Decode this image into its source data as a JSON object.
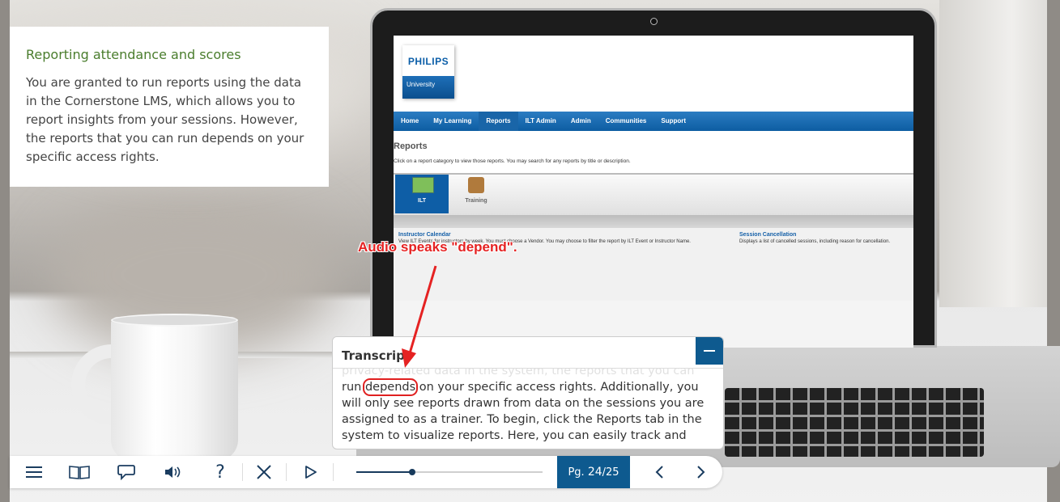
{
  "info_panel": {
    "title": "Reporting attendance and scores",
    "body": "You are granted to run reports using the data in the Cornerstone LMS, which allows you to report insights from your sessions. However, the reports that you can run depends on your specific access rights."
  },
  "laptop_screen": {
    "brand": "PHILIPS",
    "brand_sub": "University",
    "nav": [
      "Home",
      "My Learning",
      "Reports",
      "ILT Admin",
      "Admin",
      "Communities",
      "Support"
    ],
    "active_nav": "Reports",
    "page_title": "Reports",
    "page_desc": "Click on a report category to view those reports. You may search for any reports by title or description.",
    "tabs": [
      "ILT",
      "Training"
    ],
    "reports": [
      {
        "title": "Instructor Calendar",
        "desc": "View ILT Events for instructors by week. You must choose a Vendor. You may choose to filter the report by ILT Event or Instructor Name."
      },
      {
        "title": "Session Cancellation",
        "desc": "Displays a list of cancelled sessions, including reason for cancellation."
      }
    ]
  },
  "annotation": {
    "text": "Audio speaks \"depend\"."
  },
  "transcript": {
    "title": "Transcript",
    "minimize_label": "−",
    "text_before": "privacy-related data in the system, the reports that you can run ",
    "highlight": "depends",
    "text_after": " on your specific access rights. Additionally, you will only see reports drawn from data on the sessions you are assigned to as a trainer. To begin, click the Reports tab in the system to visualize reports. Here, you can easily track and"
  },
  "controls": {
    "icons": [
      "menu-icon",
      "book-icon",
      "chat-icon",
      "volume-icon",
      "help-icon",
      "close-icon",
      "play-icon",
      "prev-icon",
      "next-icon"
    ],
    "help_glyph": "?",
    "progress_fraction": 0.3,
    "page_prefix": "Pg.",
    "page_current": "24",
    "page_total": "/25"
  },
  "colors": {
    "accent_blue": "#0e5a8f",
    "title_green": "#4a7d2d",
    "annotation_red": "#e52222"
  }
}
